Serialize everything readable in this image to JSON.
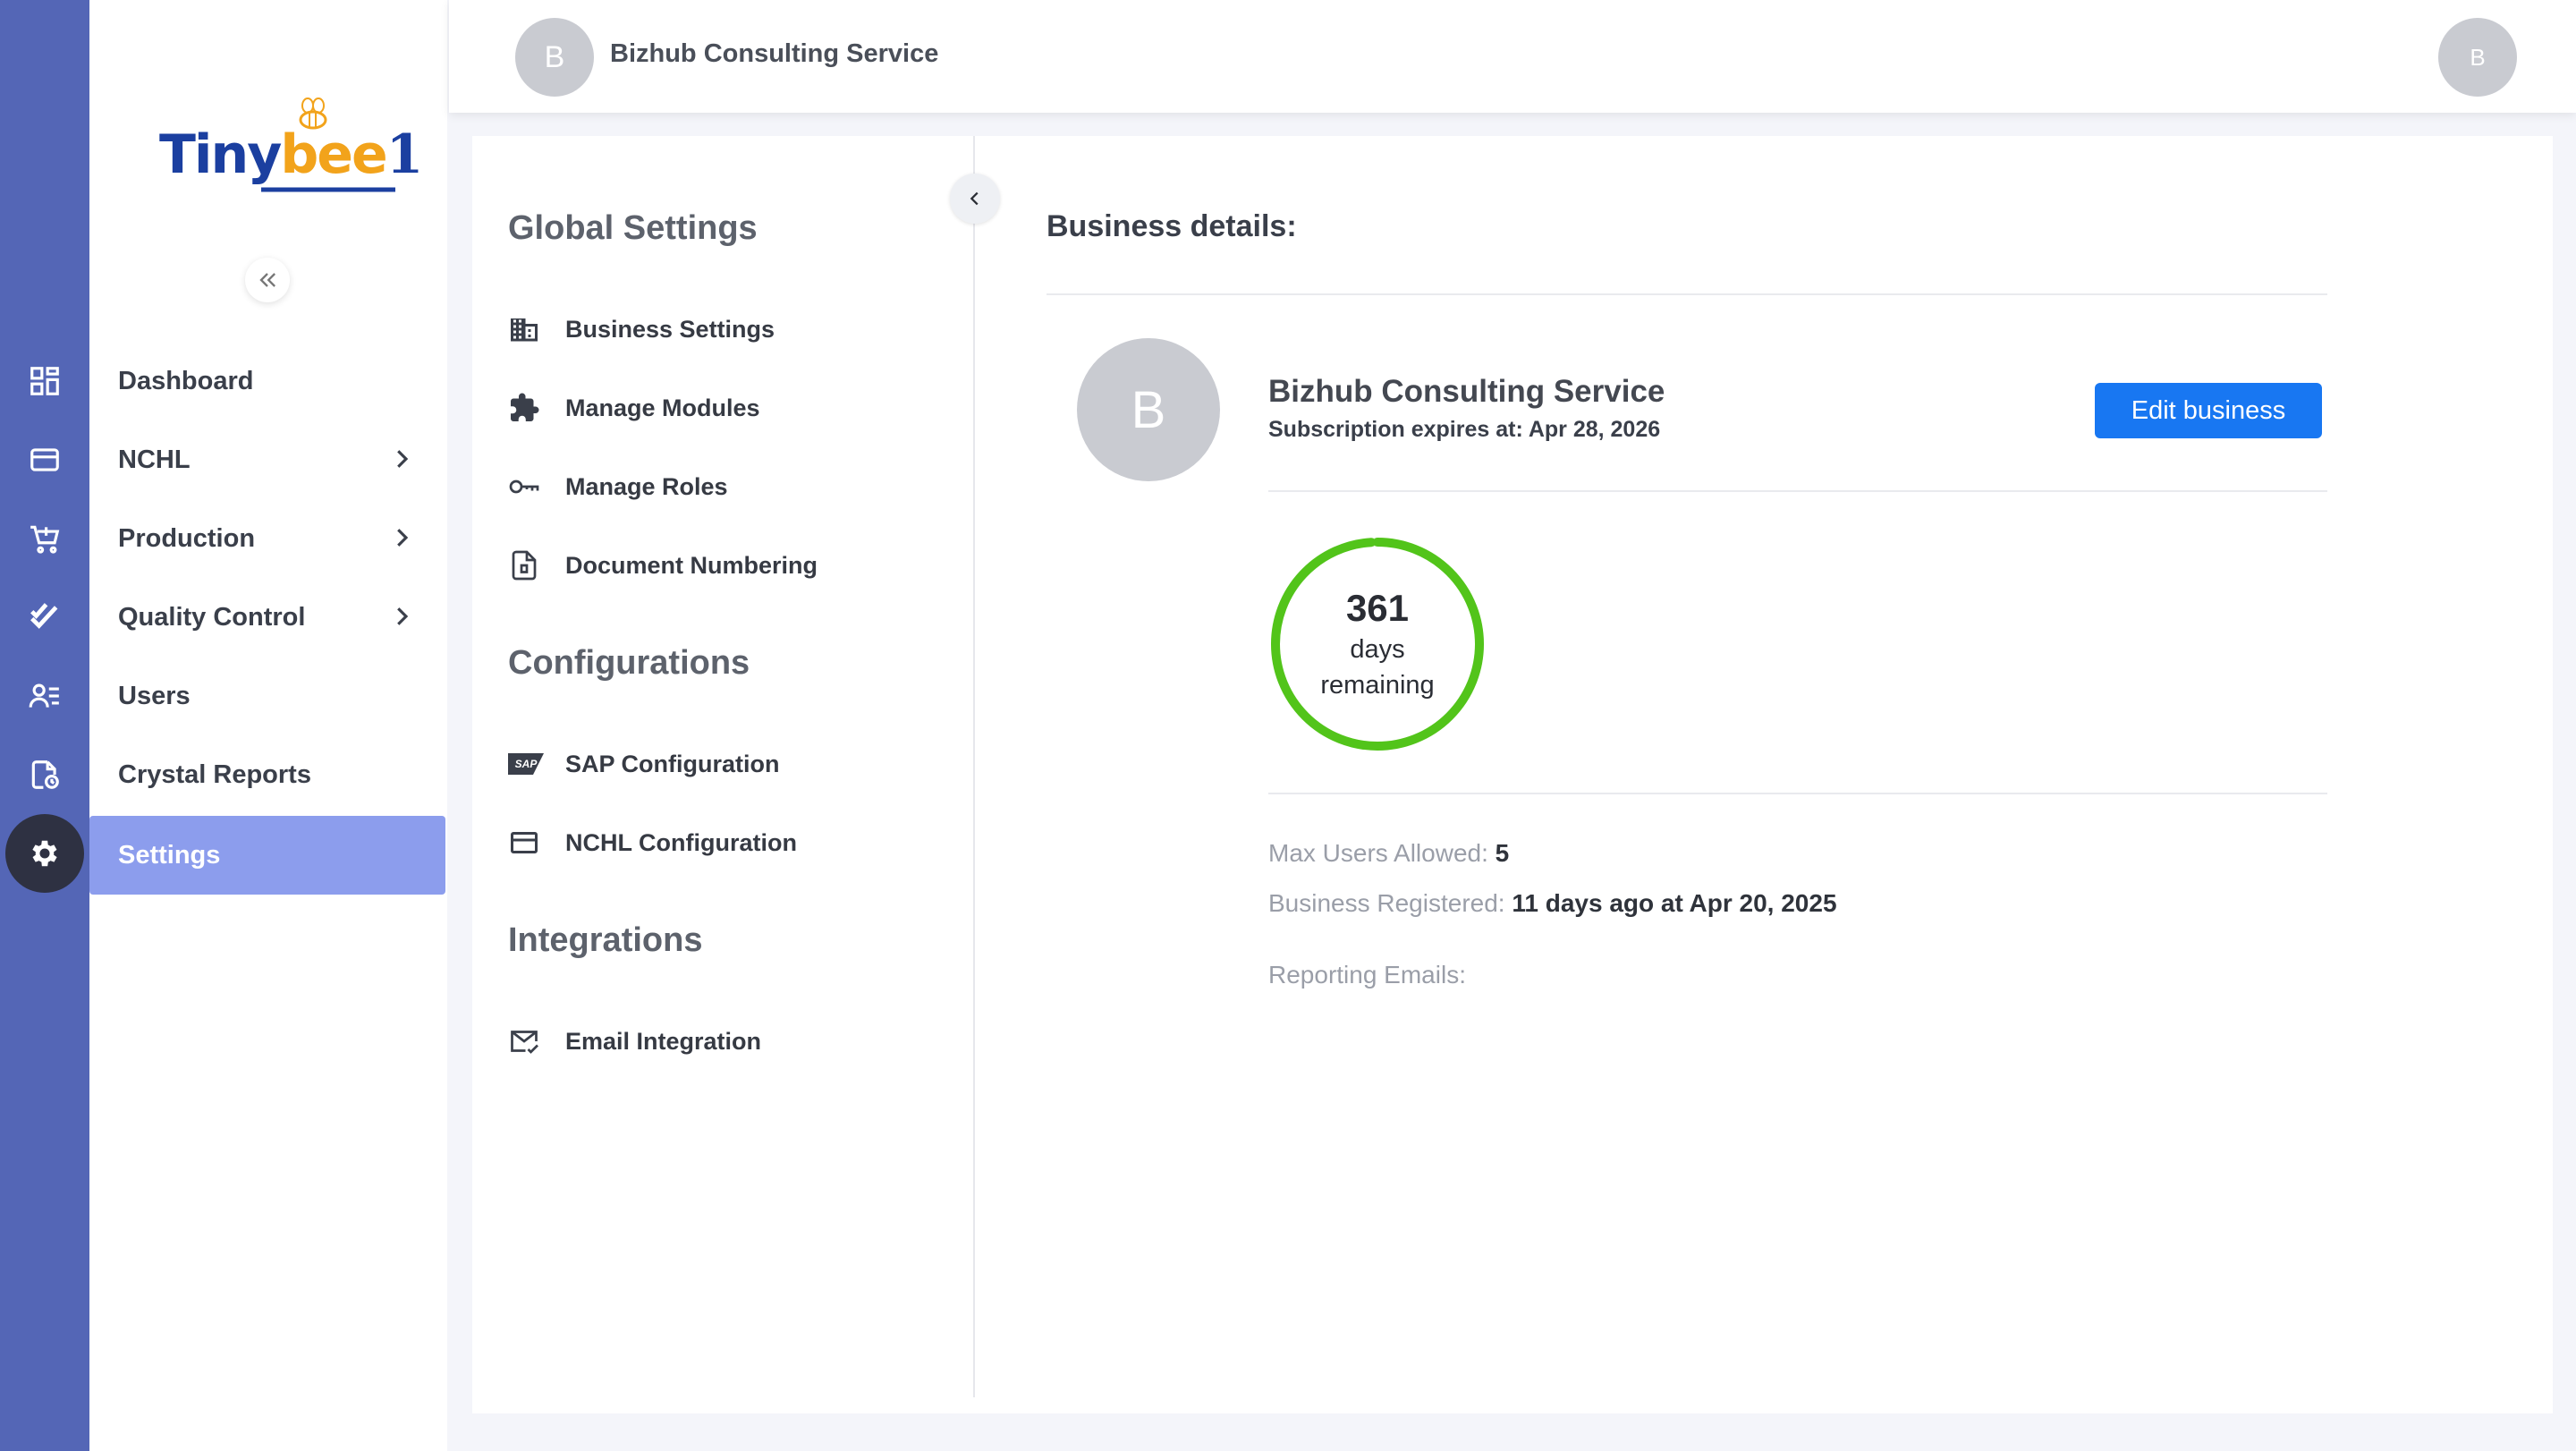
{
  "app": {
    "logo": {
      "part1": "Tiny",
      "part2": "bee",
      "part3": "1"
    },
    "colors": {
      "rail": "#5466b6",
      "active_nav": "#8c9ded",
      "accent": "#1877f2",
      "ring": "#52c41a"
    }
  },
  "rail": {
    "icons": [
      "dashboard-icon",
      "card-icon",
      "cart-icon",
      "double-check-icon",
      "users-list-icon",
      "report-icon",
      "gear-icon"
    ]
  },
  "sidebar": {
    "items": [
      {
        "label": "Dashboard",
        "has_children": false
      },
      {
        "label": "NCHL",
        "has_children": true
      },
      {
        "label": "Production",
        "has_children": true
      },
      {
        "label": "Quality Control",
        "has_children": true
      },
      {
        "label": "Users",
        "has_children": false
      },
      {
        "label": "Crystal Reports",
        "has_children": false
      },
      {
        "label": "Settings",
        "has_children": false,
        "active": true
      }
    ]
  },
  "header": {
    "avatar_initial": "B",
    "business_name": "Bizhub Consulting Service",
    "user_avatar_initial": "B"
  },
  "settings_menu": {
    "global_title": "Global Settings",
    "global_items": [
      "Business Settings",
      "Manage Modules",
      "Manage Roles",
      "Document Numbering"
    ],
    "config_title": "Configurations",
    "config_items": [
      "SAP Configuration",
      "NCHL Configuration"
    ],
    "integrations_title": "Integrations",
    "integration_items": [
      "Email Integration"
    ],
    "sap_logo_text": "SAP"
  },
  "business": {
    "section_title": "Business details:",
    "avatar_initial": "B",
    "name": "Bizhub Consulting Service",
    "subscription_label": "Subscription expires at:",
    "subscription_date": "Apr 28, 2026",
    "edit_button": "Edit business",
    "days_remaining": "361",
    "days_word": "days",
    "remaining_word": "remaining",
    "remaining_fraction": 0.99,
    "max_users_label": "Max Users Allowed:",
    "max_users": "5",
    "registered_label": "Business Registered:",
    "registered_value": "11 days ago at Apr 20, 2025",
    "reporting_emails_label": "Reporting Emails:"
  }
}
